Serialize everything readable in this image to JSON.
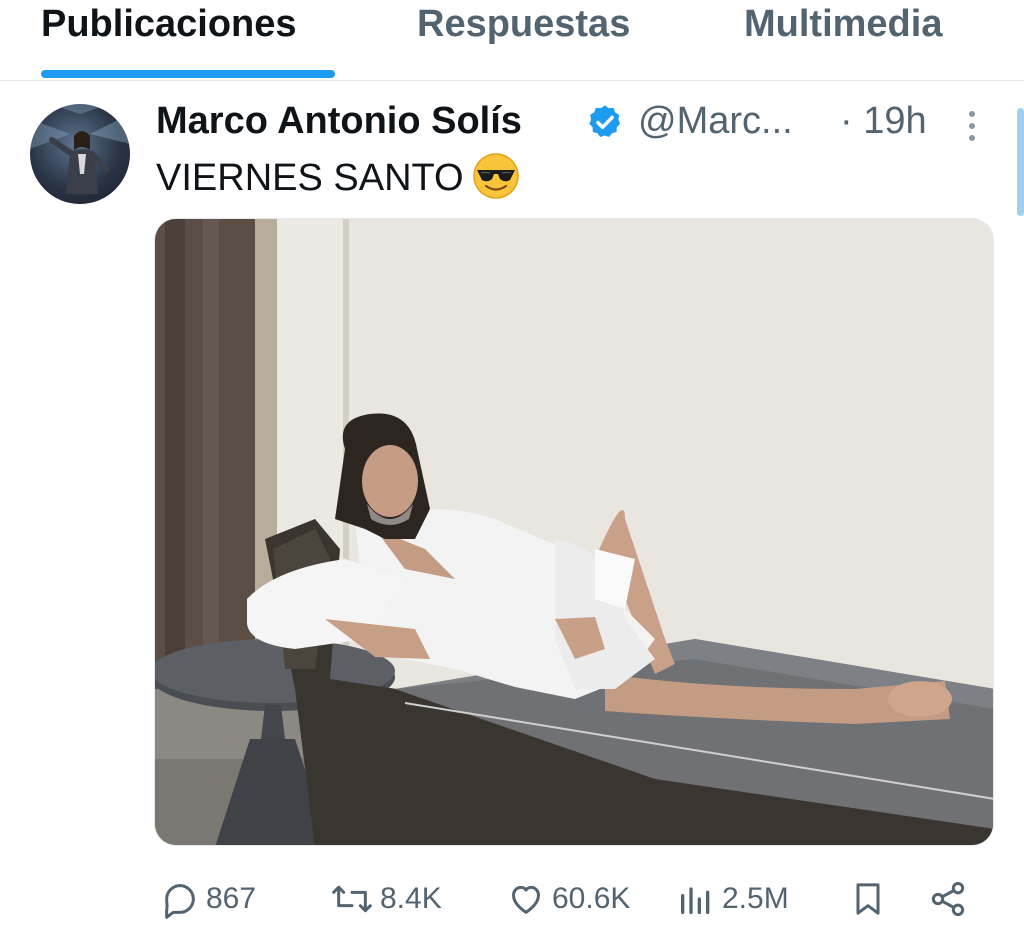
{
  "tabs": [
    {
      "label": "Publicaciones",
      "active": true
    },
    {
      "label": "Respuestas",
      "active": false
    },
    {
      "label": "Multimedia",
      "active": false
    }
  ],
  "tweet": {
    "author_name": "Marco Antonio Solís",
    "handle": "@Marc...",
    "time": "· 19h",
    "text": "VIERNES SANTO",
    "verified": true,
    "media_icon": "photo-man-in-bathrobe-on-lounger"
  },
  "actions": {
    "replies": "867",
    "reposts": "8.4K",
    "likes": "60.6K",
    "views": "2.5M"
  },
  "colors": {
    "accent": "#1d9bf0",
    "secondary_text": "#536471",
    "primary_text": "#0f1419"
  },
  "icons": [
    "more-vertical-icon",
    "verified-badge-icon",
    "smiling-face-with-sunglasses-icon",
    "reply-icon",
    "repost-icon",
    "like-icon",
    "views-icon",
    "bookmark-icon",
    "share-icon"
  ]
}
